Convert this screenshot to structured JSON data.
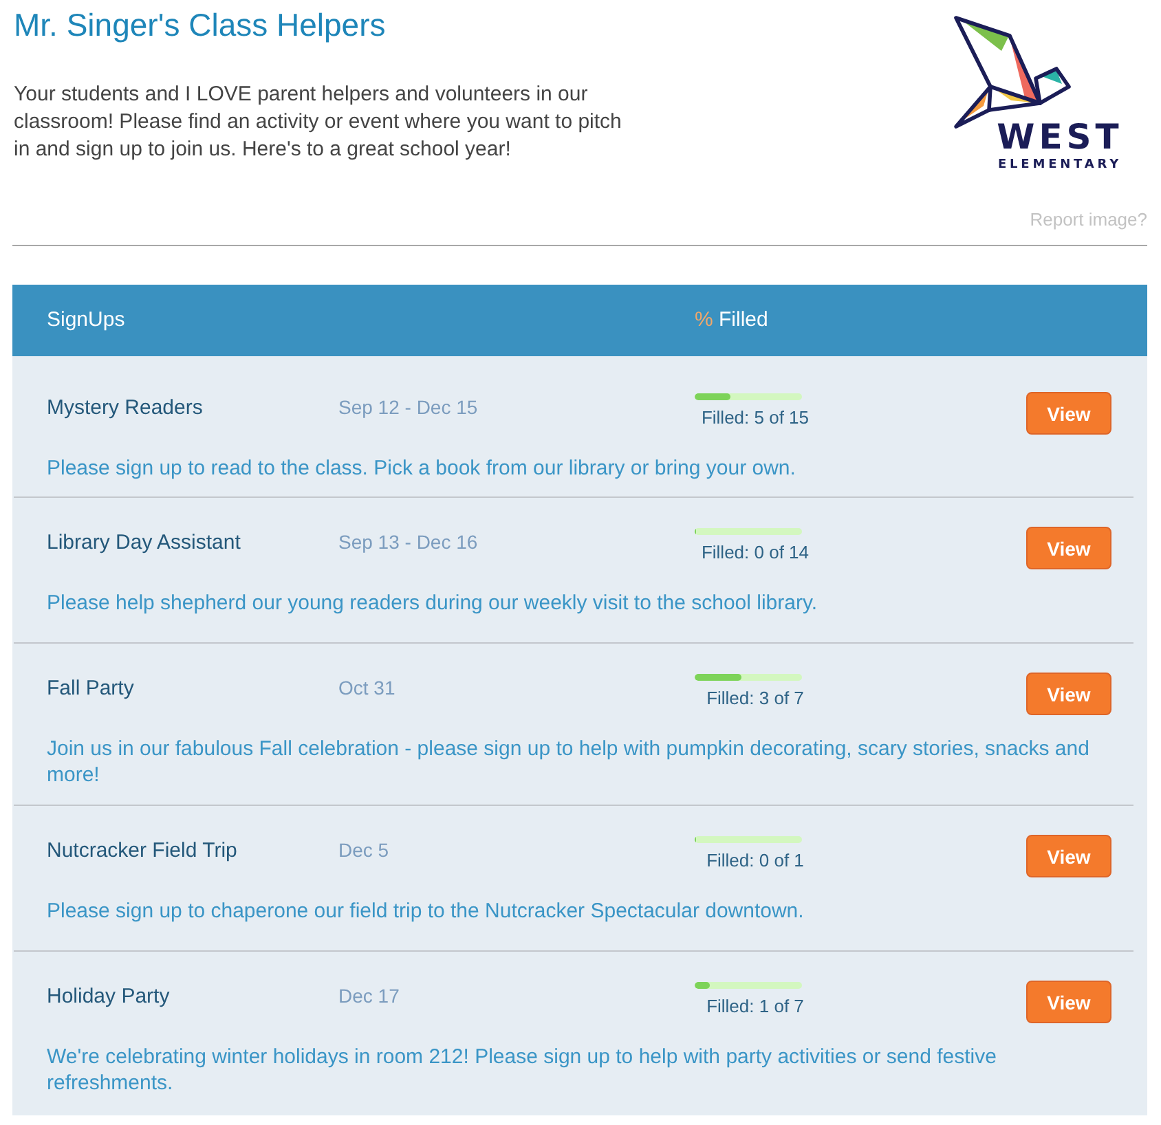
{
  "page": {
    "title": "Mr. Singer's Class Helpers",
    "intro": "Your students and I LOVE parent helpers and volunteers in our classroom! Please find an activity or event where you want to pitch in and sign up to join us. Here's to a great school year!"
  },
  "logo": {
    "name": "WEST",
    "subtitle": "ELEMENTARY"
  },
  "report_link": "Report image?",
  "table": {
    "columns": [
      {
        "label": "SignUps"
      },
      {
        "symbol": "%",
        "label": "Filled"
      }
    ],
    "rows": [
      {
        "name": "Mystery Readers",
        "dates": "Sep 12 - Dec 15",
        "level": 0.33,
        "filled": "Filled: 5 of 15",
        "action": "View",
        "description": "Please sign up to read to the class. Pick a book from our library or bring your own."
      },
      {
        "name": "Library Day Assistant",
        "dates": "Sep 13 - Dec 16",
        "level": 0,
        "filled": "Filled: 0 of 14",
        "action": "View",
        "description": "Please help shepherd our young readers during our weekly visit to the school library."
      },
      {
        "name": "Fall Party",
        "dates": "Oct 31",
        "level": 0.43,
        "filled": "Filled: 3 of 7",
        "action": "View",
        "description": "Join us in our fabulous Fall celebration - please sign up to help with pumpkin decorating, scary stories, snacks and more!"
      },
      {
        "name": "Nutcracker Field Trip",
        "dates": "Dec 5",
        "level": 0,
        "filled": "Filled: 0 of 1",
        "action": "View",
        "description": "Please sign up to chaperone our field trip to the Nutcracker Spectacular downtown."
      },
      {
        "name": "Holiday Party",
        "dates": "Dec 17",
        "level": 0.14,
        "filled": "Filled: 1 of 7",
        "action": "View",
        "description": "We're celebrating winter holidays in room 212! Please sign up to help with party activities or send festive refreshments."
      }
    ]
  }
}
